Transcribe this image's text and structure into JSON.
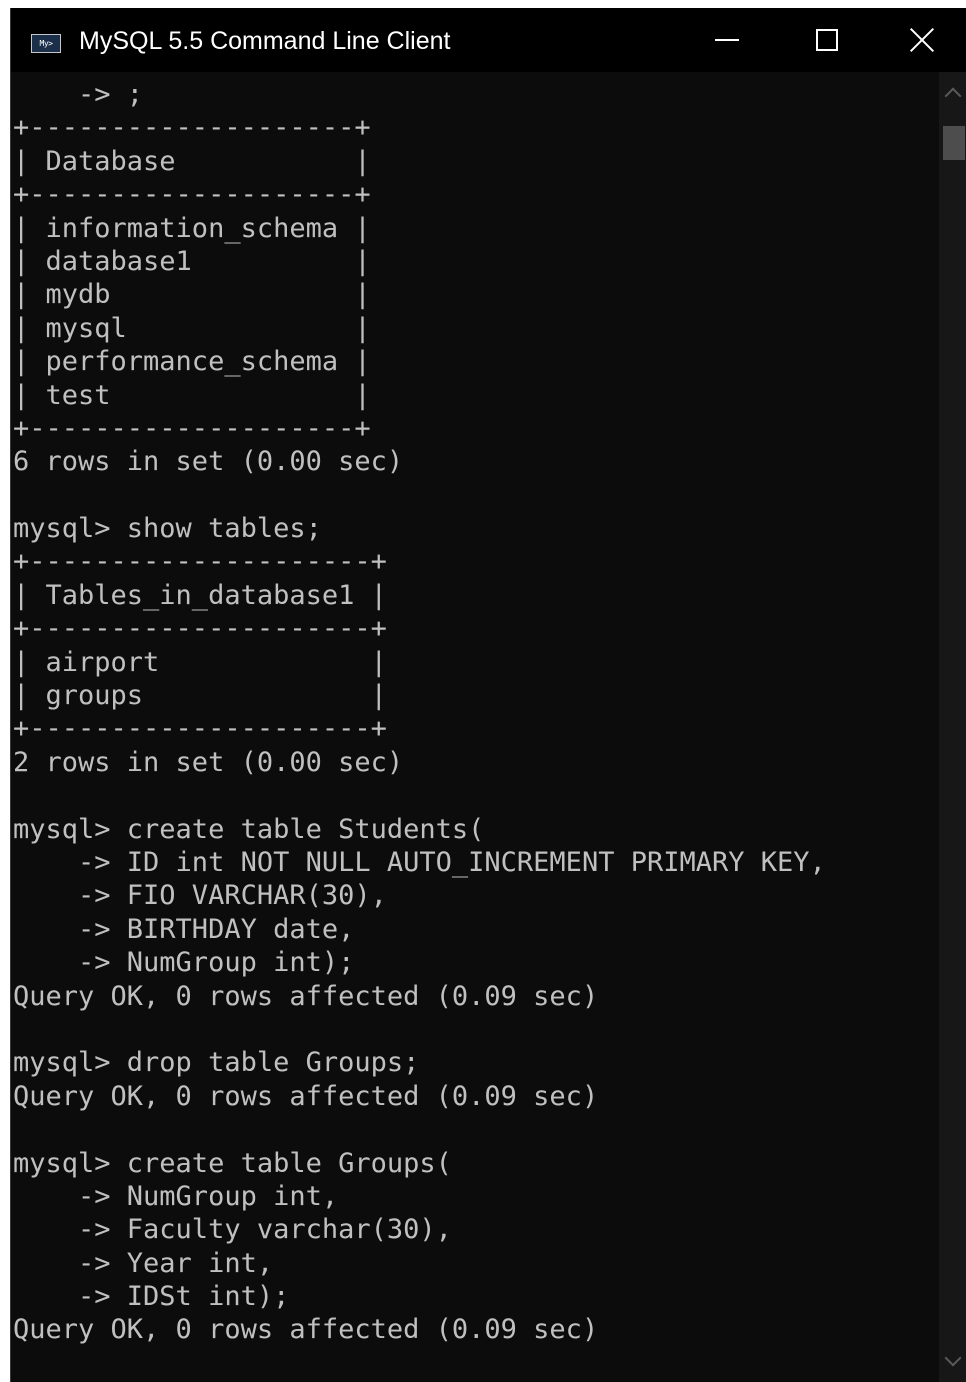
{
  "window": {
    "title": "MySQL 5.5 Command Line Client",
    "icon_text": "My>"
  },
  "console": {
    "lines": [
      "    -> ;",
      "+--------------------+",
      "| Database           |",
      "+--------------------+",
      "| information_schema |",
      "| database1          |",
      "| mydb               |",
      "| mysql              |",
      "| performance_schema |",
      "| test               |",
      "+--------------------+",
      "6 rows in set (0.00 sec)",
      "",
      "mysql> show tables;",
      "+---------------------+",
      "| Tables_in_database1 |",
      "+---------------------+",
      "| airport             |",
      "| groups              |",
      "+---------------------+",
      "2 rows in set (0.00 sec)",
      "",
      "mysql> create table Students(",
      "    -> ID int NOT NULL AUTO_INCREMENT PRIMARY KEY,",
      "    -> FIO VARCHAR(30),",
      "    -> BIRTHDAY date,",
      "    -> NumGroup int);",
      "Query OK, 0 rows affected (0.09 sec)",
      "",
      "mysql> drop table Groups;",
      "Query OK, 0 rows affected (0.09 sec)",
      "",
      "mysql> create table Groups(",
      "    -> NumGroup int,",
      "    -> Faculty varchar(30),",
      "    -> Year int,",
      "    -> IDSt int);",
      "Query OK, 0 rows affected (0.09 sec)"
    ]
  },
  "colors": {
    "background": "#0c0c0c",
    "text": "#c0c0c0",
    "titlebar": "#000000"
  }
}
